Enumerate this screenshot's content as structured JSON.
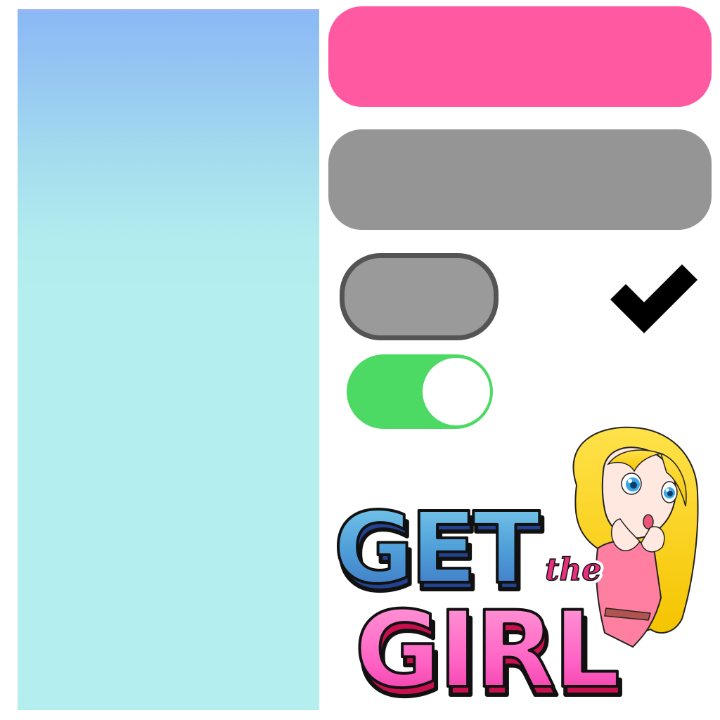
{
  "colors": {
    "pink_button": "#ff59a1",
    "gray_button": "#959595",
    "gray_pill_fill": "#9a9a9a",
    "gray_pill_border": "#545454",
    "toggle_on": "#4cd964",
    "checkmark": "#000000"
  },
  "toggle": {
    "state": "on"
  },
  "checkbox": {
    "checked": true,
    "icon": "checkmark-icon"
  },
  "logo": {
    "word_top": "GET",
    "word_middle": "the",
    "word_bottom": "GIRL"
  }
}
